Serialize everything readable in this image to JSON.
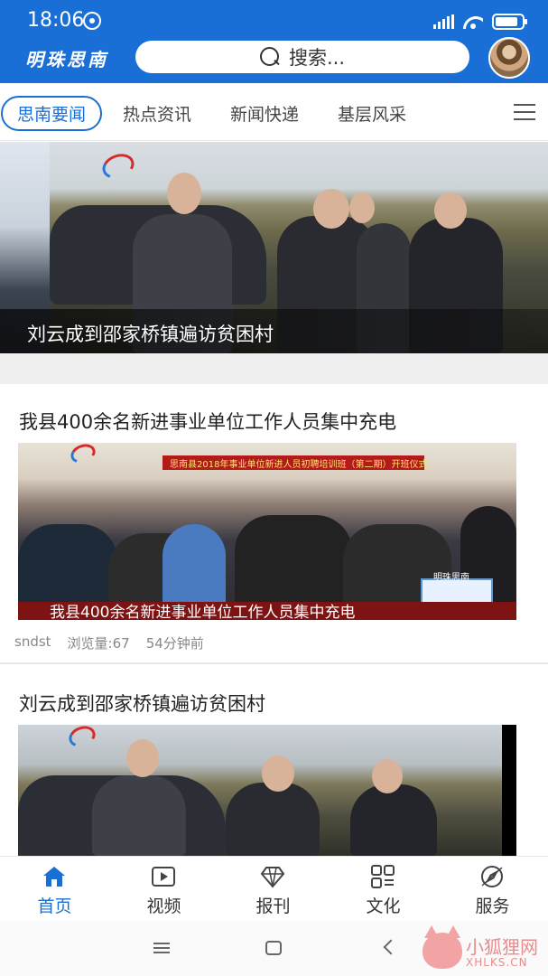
{
  "status_bar": {
    "time": "18:06"
  },
  "header": {
    "app_logo": "明珠思南",
    "search_placeholder": "搜索...",
    "brand_color": "#1a6fd6"
  },
  "tabs": [
    {
      "label": "思南要闻",
      "active": true
    },
    {
      "label": "热点资讯",
      "active": false
    },
    {
      "label": "新闻快递",
      "active": false
    },
    {
      "label": "基层风采",
      "active": false
    }
  ],
  "banner": {
    "caption": "刘云成到邵家桥镇遍访贫困村"
  },
  "articles": [
    {
      "title": "我县400余名新进事业单位工作人员集中充电",
      "thumb_banner_text": "思南县2018年事业单位新进人员初聘培训班（第二期）开班仪式",
      "thumb_caption": "我县400余名新进事业单位工作人员集中充电",
      "thumb_logo_text": "明珠思南",
      "author": "sndst",
      "views": "浏览量:67",
      "time": "54分钟前"
    },
    {
      "title": "刘云成到邵家桥镇遍访贫困村"
    }
  ],
  "bottom_nav": [
    {
      "label": "首页",
      "icon": "home-icon",
      "active": true
    },
    {
      "label": "视频",
      "icon": "video-icon",
      "active": false
    },
    {
      "label": "报刊",
      "icon": "diamond-icon",
      "active": false
    },
    {
      "label": "文化",
      "icon": "grid-icon",
      "active": false
    },
    {
      "label": "服务",
      "icon": "compass-icon",
      "active": false
    }
  ],
  "watermark": {
    "name": "小狐狸网",
    "domain": "XHLKS.CN"
  }
}
